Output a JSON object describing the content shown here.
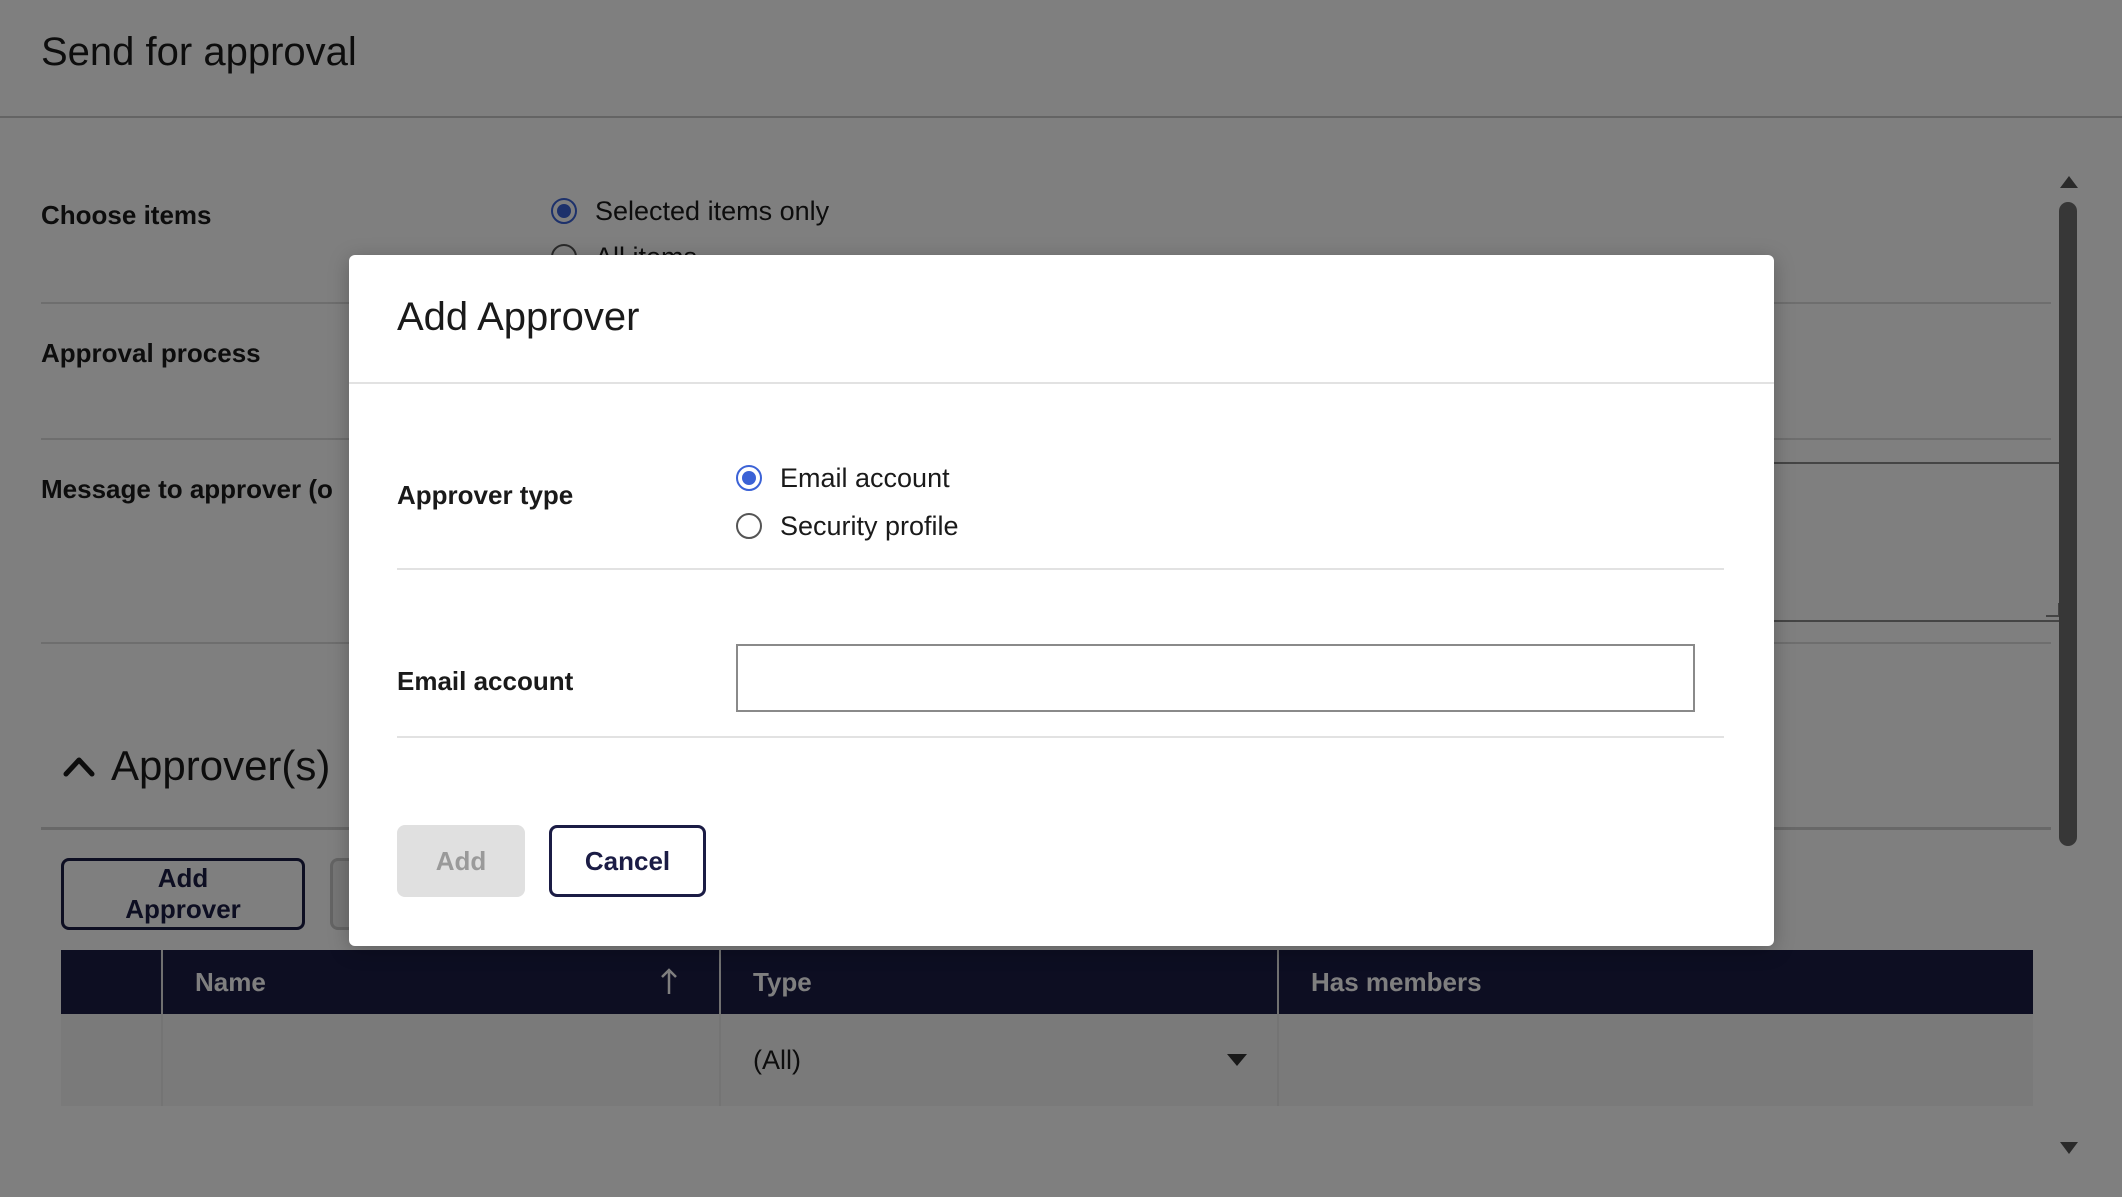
{
  "page": {
    "title": "Send for approval",
    "choose_items": {
      "label": "Choose items",
      "options": [
        "Selected items only",
        "All items"
      ],
      "selected": 0
    },
    "approval_process": {
      "label": "Approval process"
    },
    "message": {
      "label": "Message to approver (o"
    },
    "approvers_section": {
      "title": "Approver(s)",
      "add_button": "Add Approver"
    },
    "table": {
      "columns": [
        "Name",
        "Type",
        "Has members"
      ],
      "type_filter": "(All)"
    }
  },
  "modal": {
    "title": "Add Approver",
    "approver_type": {
      "label": "Approver type",
      "options": [
        "Email account",
        "Security profile"
      ],
      "selected": 0
    },
    "email_account": {
      "label": "Email account",
      "value": "",
      "placeholder": ""
    },
    "buttons": {
      "add": "Add",
      "cancel": "Cancel"
    }
  },
  "colors": {
    "accent": "#3b62d6",
    "navy": "#1b1c45",
    "overlay": "rgba(0,0,0,0.5)"
  }
}
